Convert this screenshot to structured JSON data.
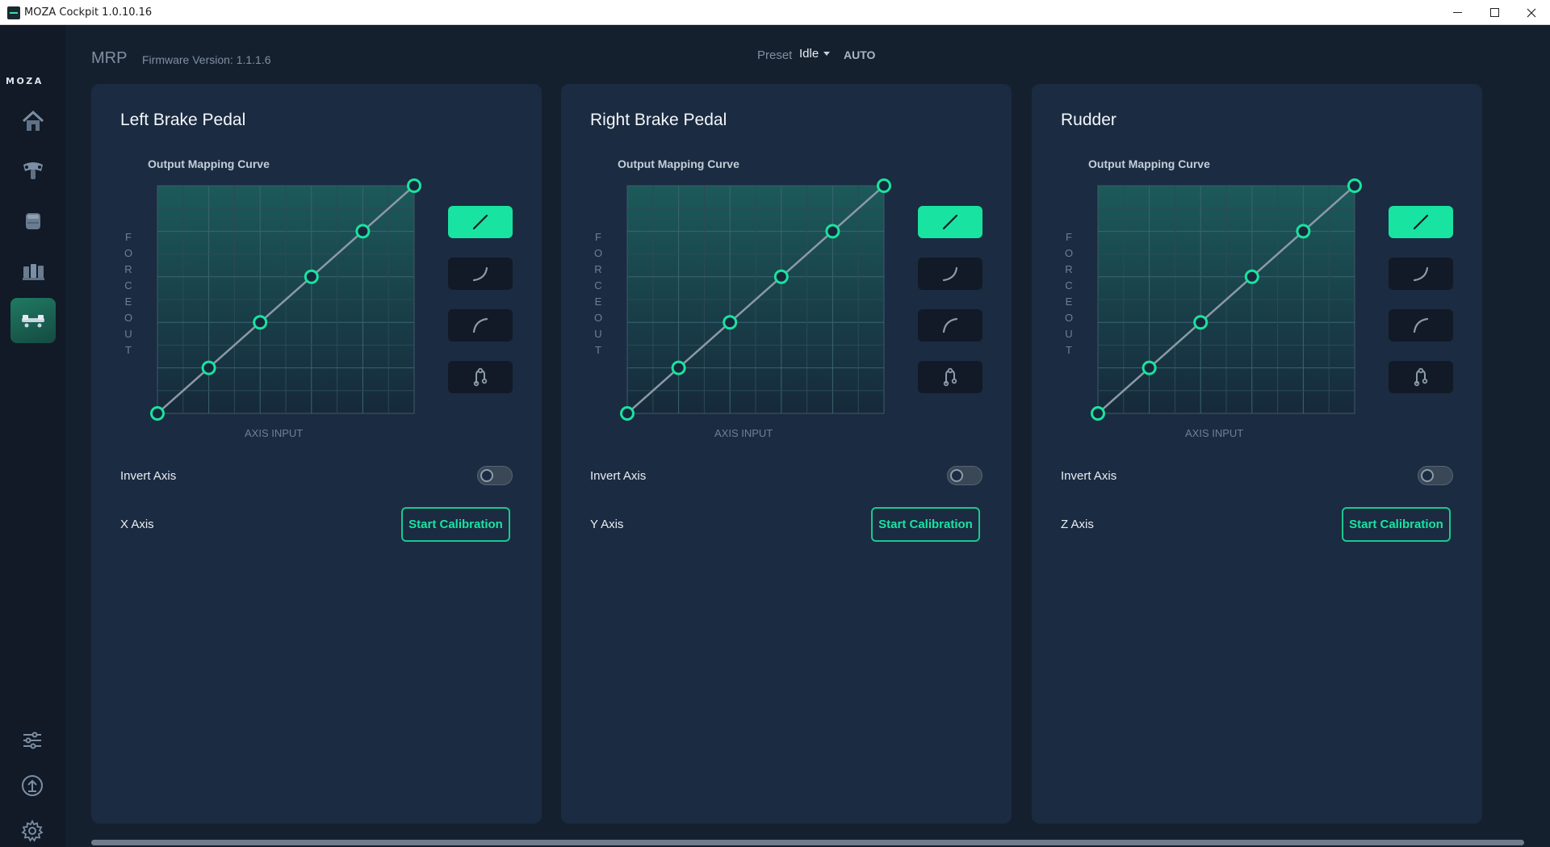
{
  "window": {
    "title": "MOZA Cockpit 1.0.10.16",
    "controls": [
      "minimize",
      "maximize",
      "close"
    ]
  },
  "sidebar": {
    "brand": "MOZA",
    "nav": [
      {
        "name": "home",
        "icon": "home-icon",
        "active": false
      },
      {
        "name": "steering-wheel",
        "icon": "steering-wheel-icon",
        "active": false
      },
      {
        "name": "wheelbase",
        "icon": "wheelbase-icon",
        "active": false
      },
      {
        "name": "pedals",
        "icon": "pedals-icon",
        "active": false
      },
      {
        "name": "rudder-pedals",
        "icon": "rudder-pedals-icon",
        "active": true
      }
    ],
    "utilities": [
      {
        "name": "sliders",
        "icon": "sliders-icon"
      },
      {
        "name": "firmware-upgrade",
        "icon": "upload-icon"
      },
      {
        "name": "settings",
        "icon": "gear-icon"
      }
    ]
  },
  "header": {
    "device": "MRP",
    "firmware": "Firmware Version: 1.1.1.6",
    "preset_label": "Preset",
    "preset_value": "Idle",
    "auto_label": "AUTO"
  },
  "colors": {
    "accent": "#19e3a0",
    "panel": "#1b2b41",
    "background": "#15202e",
    "sidebar": "#111a26"
  },
  "panels": [
    {
      "id": "left-brake",
      "title": "Left Brake Pedal",
      "curve_label": "Output Mapping Curve",
      "y_axis_label": "FORCE OUT",
      "x_axis_label": "AXIS INPUT",
      "curve_points": [
        [
          0,
          0
        ],
        [
          20,
          20
        ],
        [
          40,
          40
        ],
        [
          60,
          60
        ],
        [
          80,
          80
        ],
        [
          100,
          100
        ]
      ],
      "invert_label": "Invert Axis",
      "invert_enabled": false,
      "axis_name": "X Axis",
      "calibration_label": "Start Calibration",
      "active_preset": "linear"
    },
    {
      "id": "right-brake",
      "title": "Right Brake Pedal",
      "curve_label": "Output Mapping Curve",
      "y_axis_label": "FORCE OUT",
      "x_axis_label": "AXIS INPUT",
      "curve_points": [
        [
          0,
          0
        ],
        [
          20,
          20
        ],
        [
          40,
          40
        ],
        [
          60,
          60
        ],
        [
          80,
          80
        ],
        [
          100,
          100
        ]
      ],
      "invert_label": "Invert Axis",
      "invert_enabled": false,
      "axis_name": "Y Axis",
      "calibration_label": "Start Calibration",
      "active_preset": "linear"
    },
    {
      "id": "rudder",
      "title": "Rudder",
      "curve_label": "Output Mapping Curve",
      "y_axis_label": "FORCE OUT",
      "x_axis_label": "AXIS INPUT",
      "curve_points": [
        [
          0,
          0
        ],
        [
          20,
          20
        ],
        [
          40,
          40
        ],
        [
          60,
          60
        ],
        [
          80,
          80
        ],
        [
          100,
          100
        ]
      ],
      "invert_label": "Invert Axis",
      "invert_enabled": false,
      "axis_name": "Z Axis",
      "calibration_label": "Start Calibration",
      "active_preset": "linear"
    }
  ],
  "curve_presets": [
    {
      "name": "linear",
      "icon": "linear-curve-icon"
    },
    {
      "name": "exponential",
      "icon": "exponential-curve-icon"
    },
    {
      "name": "logarithmic",
      "icon": "logarithmic-curve-icon"
    },
    {
      "name": "custom",
      "icon": "custom-curve-icon"
    }
  ]
}
